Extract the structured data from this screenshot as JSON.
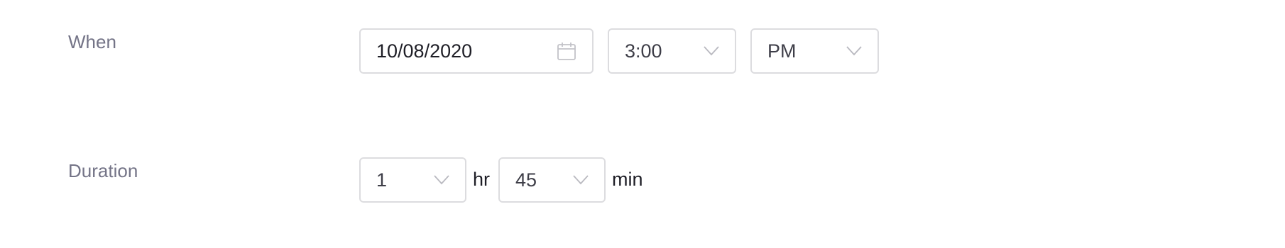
{
  "when": {
    "label": "When",
    "date": {
      "value": "10/08/2020",
      "icon": "calendar-icon"
    },
    "time": {
      "value": "3:00",
      "icon": "chevron-down-icon"
    },
    "meridiem": {
      "value": "PM",
      "icon": "chevron-down-icon"
    }
  },
  "duration": {
    "label": "Duration",
    "hours": {
      "value": "1",
      "icon": "chevron-down-icon"
    },
    "hours_unit": "hr",
    "minutes": {
      "value": "45",
      "icon": "chevron-down-icon"
    },
    "minutes_unit": "min"
  },
  "colors": {
    "label": "#747487",
    "border": "#dcdcdf",
    "text": "#1e1e26",
    "icon": "#bdbdc4"
  }
}
